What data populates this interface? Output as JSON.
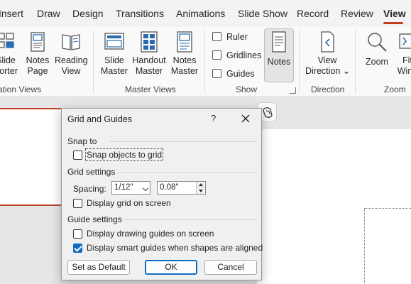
{
  "tabs": [
    "Insert",
    "Draw",
    "Design",
    "Transitions",
    "Animations",
    "Slide Show",
    "Record",
    "Review",
    "View"
  ],
  "active_tab": "View",
  "ribbon": {
    "presentation_views": {
      "slide_sorter": [
        "Slide",
        "Sorter"
      ],
      "notes_page": [
        "Notes",
        "Page"
      ],
      "reading_view": [
        "Reading",
        "View"
      ],
      "label": "ation Views"
    },
    "master_views": {
      "slide_master": [
        "Slide",
        "Master"
      ],
      "handout_master": [
        "Handout",
        "Master"
      ],
      "notes_master": [
        "Notes",
        "Master"
      ],
      "label": "Master Views"
    },
    "show": {
      "ruler": "Ruler",
      "gridlines": "Gridlines",
      "guides": "Guides",
      "notes": "Notes",
      "label": "Show"
    },
    "direction": {
      "view_direction": [
        "View",
        "Direction"
      ],
      "label": "Direction"
    },
    "zoom": {
      "zoom": "Zoom",
      "fit_window": [
        "Fit",
        "Wind"
      ],
      "label": "Zoom"
    }
  },
  "dialog": {
    "title": "Grid and Guides",
    "help": "?",
    "snap_to": {
      "label": "Snap to",
      "snap_objects": "Snap objects to grid",
      "snap_objects_checked": false
    },
    "grid_settings": {
      "label": "Grid settings",
      "spacing_label": "Spacing:",
      "spacing_preset": "1/12\"",
      "spacing_value": "0.08\"",
      "display_grid": "Display grid on screen",
      "display_grid_checked": false
    },
    "guide_settings": {
      "label": "Guide settings",
      "display_drawing_guides": "Display drawing guides on screen",
      "display_drawing_guides_checked": false,
      "display_smart_guides": "Display smart guides when shapes are aligned",
      "display_smart_guides_checked": true
    },
    "buttons": {
      "set_default": "Set as Default",
      "ok": "OK",
      "cancel": "Cancel"
    }
  },
  "colors": {
    "accent": "#c43e1c",
    "check_blue": "#0f6cbd",
    "icon_blue": "#2b6cb0"
  }
}
